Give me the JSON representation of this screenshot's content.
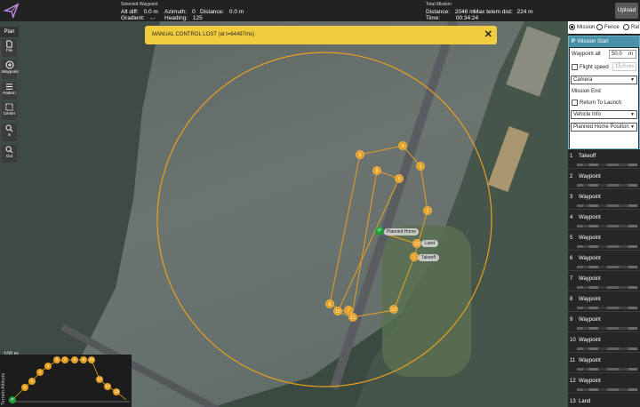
{
  "topbar": {
    "selected_waypoint_title": "Selected Waypoint",
    "alt_diff_label": "Alt diff:",
    "alt_diff_value": "0.0 m",
    "azimuth_label": "Azimuth:",
    "azimuth_value": "0",
    "distance_label": "Distance:",
    "distance_value": "0.0 m",
    "gradient_label": "Gradient:",
    "gradient_value": "-.-",
    "heading_label": "Heading:",
    "heading_value": "125",
    "total_mission_title": "Total Mission",
    "total_distance_label": "Distance:",
    "total_distance_value": "2046 m",
    "max_telem_label": "Max telem dist:",
    "max_telem_value": "224 m",
    "time_label": "Time:",
    "time_value": "00:34:24",
    "upload_label": "Upload"
  },
  "leftbar": {
    "plan_label": "Plan",
    "tools": [
      "File",
      "Waypoint",
      "Pattern",
      "Center",
      "In",
      "Out"
    ]
  },
  "banner": {
    "message": "MANUAL CONTROL LOST (at t=64497ms)",
    "close": "✕"
  },
  "map": {
    "planned_home_label": "Planned Home",
    "land_label": "Land",
    "takeoff_label": "Takeoff",
    "home_marker": "P",
    "scale_text": "100 m",
    "waypoint_numbers": [
      "1",
      "2",
      "3",
      "4",
      "5",
      "6",
      "7",
      "8",
      "9",
      "10",
      "11",
      "12",
      "13"
    ]
  },
  "terrain": {
    "title": "Terrain Altitude",
    "home_marker": "P",
    "numbers": [
      "2",
      "3",
      "4",
      "5",
      "6",
      "7",
      "8",
      "9",
      "10",
      "11",
      "12",
      "13"
    ]
  },
  "rpanel": {
    "tabs": [
      "Mission",
      "Fence",
      "Ral"
    ],
    "mission_start": "Mission Start",
    "waypoint_alt_label": "Waypoint alt",
    "waypoint_alt_value": "50.0",
    "waypoint_alt_unit": "m",
    "flight_speed_label": "Flight speed",
    "flight_speed_value": "15.0",
    "flight_speed_unit": "m/s",
    "camera_label": "Camera",
    "mission_end_label": "Mission End",
    "return_to_launch_label": "Return To Launch",
    "vehicle_info_label": "Vehicle Info",
    "planned_home_label": "Planned Home Position",
    "items": [
      {
        "num": "1",
        "label": "Takeoff"
      },
      {
        "num": "2",
        "label": "Waypoint"
      },
      {
        "num": "3",
        "label": "Waypoint"
      },
      {
        "num": "4",
        "label": "Waypoint"
      },
      {
        "num": "5",
        "label": "Waypoint"
      },
      {
        "num": "6",
        "label": "Waypoint"
      },
      {
        "num": "7",
        "label": "Waypoint"
      },
      {
        "num": "8",
        "label": "Waypoint"
      },
      {
        "num": "9",
        "label": "Waypoint"
      },
      {
        "num": "10",
        "label": "Waypoint"
      },
      {
        "num": "11",
        "label": "Waypoint"
      },
      {
        "num": "12",
        "label": "Waypoint"
      },
      {
        "num": "13",
        "label": "Land"
      }
    ]
  },
  "colors": {
    "accent": "#e8a020",
    "banner": "#f2cc3f",
    "home_green": "#1e9e3a",
    "panel_blue": "#4a90a8"
  }
}
